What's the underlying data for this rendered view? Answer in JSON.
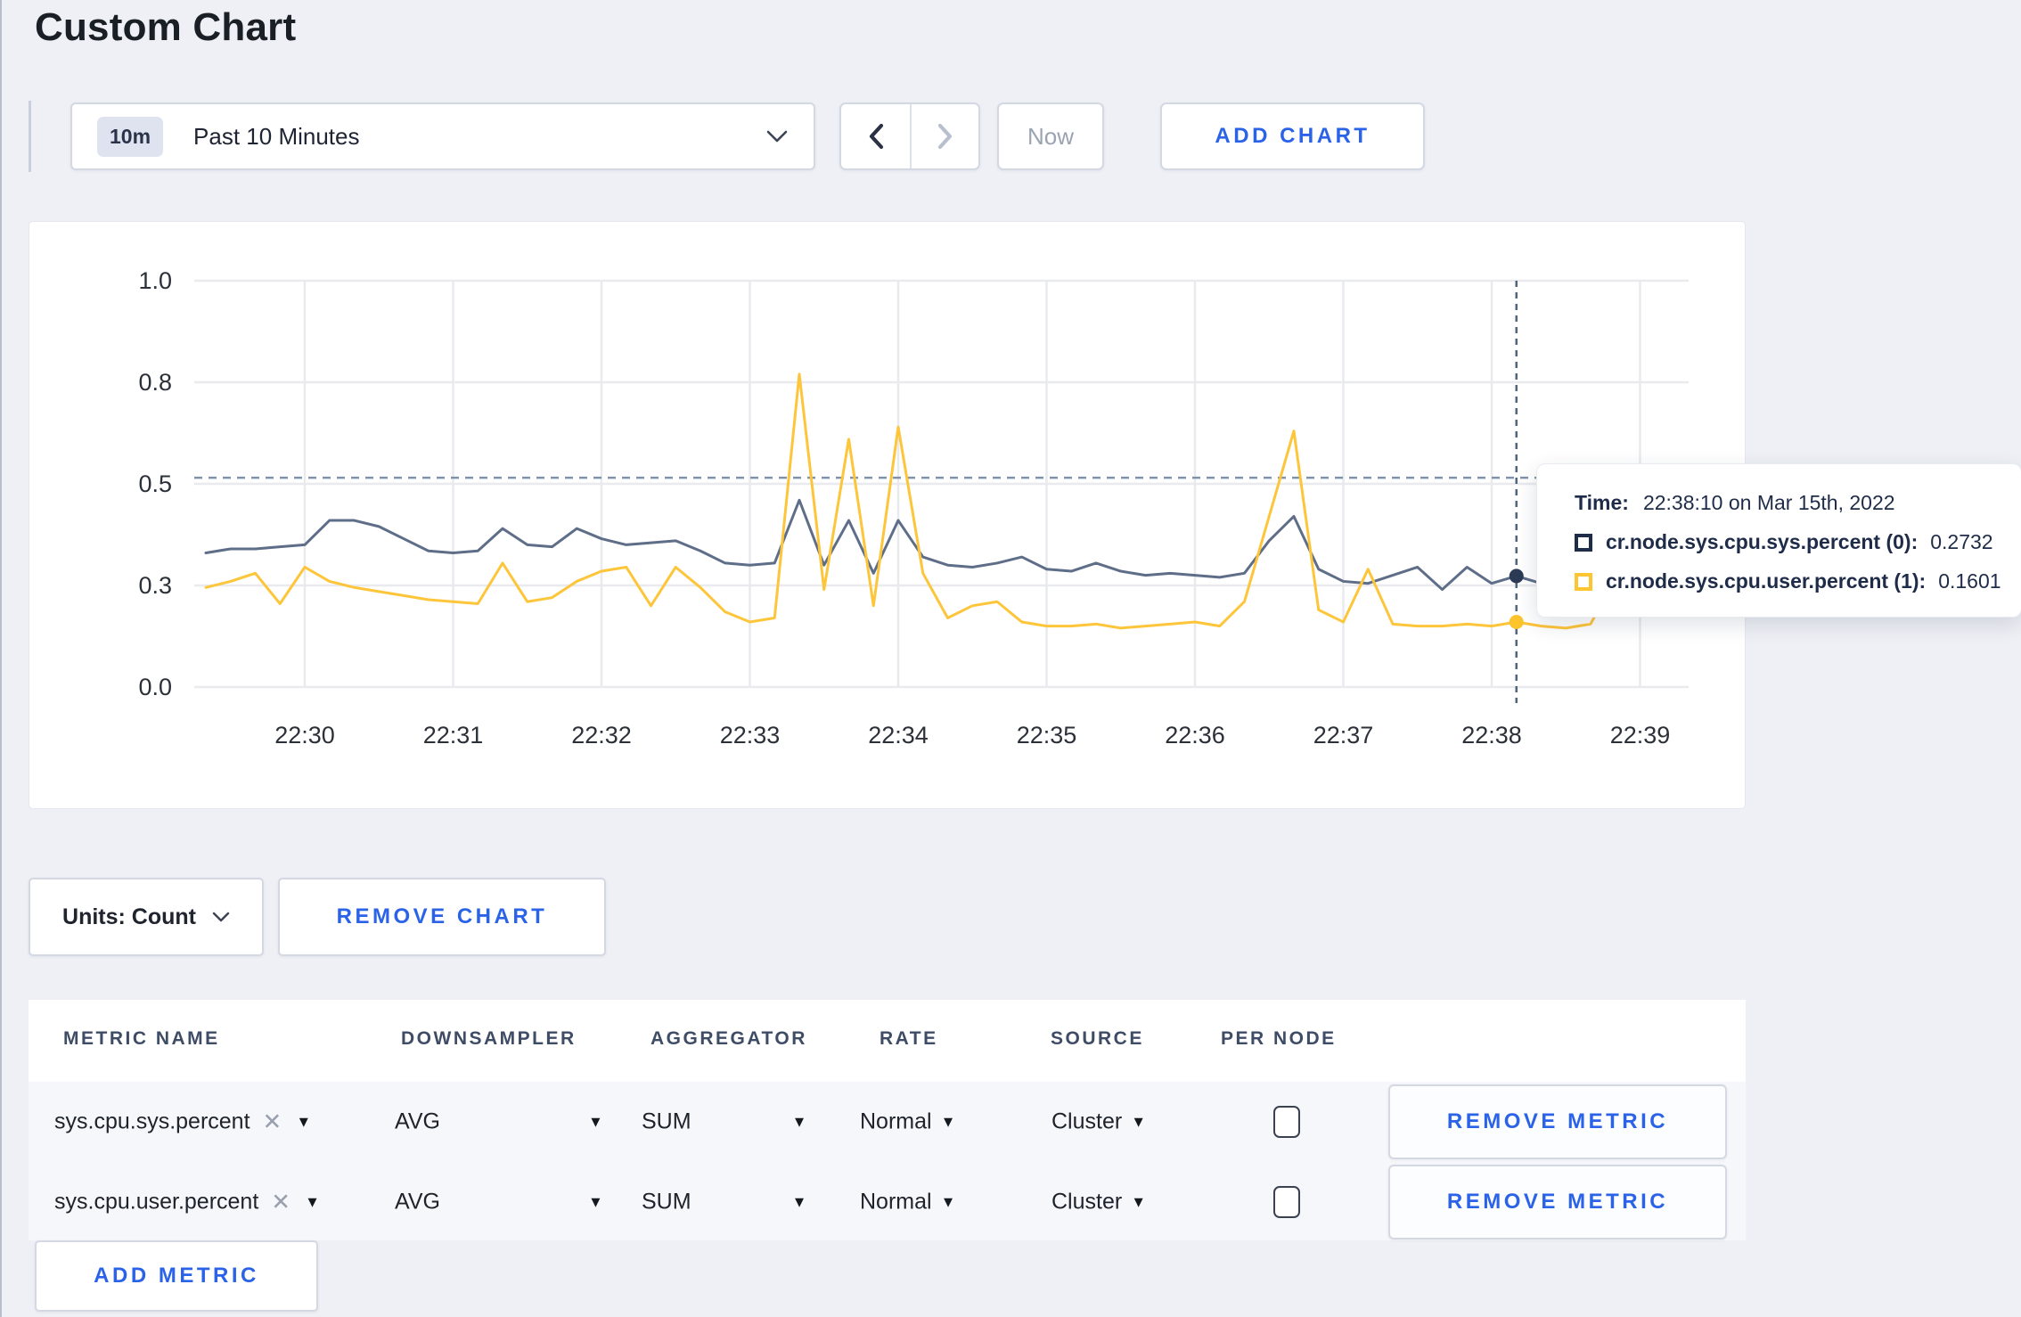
{
  "title": "Custom Chart",
  "controls": {
    "time_window_badge": "10m",
    "time_window_label": "Past 10 Minutes",
    "now_label": "Now",
    "add_chart_label": "ADD CHART"
  },
  "chart_footer": {
    "units_label": "Units: Count",
    "remove_chart_label": "REMOVE CHART"
  },
  "tooltip": {
    "time_label": "Time:",
    "time_value": "22:38:10 on Mar 15th, 2022",
    "series": [
      {
        "label": "cr.node.sys.cpu.sys.percent (0):",
        "value": "0.2732",
        "color": "#1f2c49"
      },
      {
        "label": "cr.node.sys.cpu.user.percent (1):",
        "value": "0.1601",
        "color": "#fdc530"
      }
    ]
  },
  "table": {
    "headers": [
      "METRIC NAME",
      "DOWNSAMPLER",
      "AGGREGATOR",
      "RATE",
      "SOURCE",
      "PER NODE"
    ],
    "rows": [
      {
        "metric": "sys.cpu.sys.percent",
        "downsampler": "AVG",
        "aggregator": "SUM",
        "rate": "Normal",
        "source": "Cluster",
        "per_node_checked": false,
        "remove_label": "REMOVE METRIC"
      },
      {
        "metric": "sys.cpu.user.percent",
        "downsampler": "AVG",
        "aggregator": "SUM",
        "rate": "Normal",
        "source": "Cluster",
        "per_node_checked": false,
        "remove_label": "REMOVE METRIC"
      }
    ],
    "add_metric_label": "ADD METRIC"
  },
  "chart_data": {
    "type": "line",
    "x_start": "22:29:20",
    "x_step_seconds": 10,
    "x_tick_labels": [
      "22:30",
      "22:31",
      "22:32",
      "22:33",
      "22:34",
      "22:35",
      "22:36",
      "22:37",
      "22:38",
      "22:39"
    ],
    "y_ticks": [
      {
        "value": 0.0,
        "label": "0.0"
      },
      {
        "value": 0.25,
        "label": "0.3"
      },
      {
        "value": 0.5,
        "label": "0.5"
      },
      {
        "value": 0.75,
        "label": "0.8"
      },
      {
        "value": 1.0,
        "label": "1.0"
      }
    ],
    "ylim": [
      0,
      1
    ],
    "grid": true,
    "series": [
      {
        "name": "cr.node.sys.cpu.sys.percent",
        "color": "#5f6e88",
        "values": [
          0.33,
          0.34,
          0.34,
          0.345,
          0.35,
          0.41,
          0.41,
          0.395,
          0.365,
          0.335,
          0.33,
          0.335,
          0.39,
          0.35,
          0.345,
          0.39,
          0.365,
          0.35,
          0.355,
          0.36,
          0.335,
          0.305,
          0.3,
          0.305,
          0.46,
          0.3,
          0.41,
          0.28,
          0.41,
          0.32,
          0.3,
          0.295,
          0.305,
          0.32,
          0.29,
          0.285,
          0.305,
          0.285,
          0.275,
          0.28,
          0.275,
          0.27,
          0.28,
          0.36,
          0.42,
          0.29,
          0.26,
          0.255,
          0.275,
          0.295,
          0.24,
          0.295,
          0.255,
          0.2732,
          0.255,
          0.265,
          0.275,
          0.265,
          0.27,
          0.265,
          0.27
        ]
      },
      {
        "name": "cr.node.sys.cpu.user.percent",
        "color": "#fdc53a",
        "values": [
          0.245,
          0.26,
          0.28,
          0.205,
          0.295,
          0.26,
          0.245,
          0.235,
          0.225,
          0.215,
          0.21,
          0.205,
          0.305,
          0.21,
          0.22,
          0.26,
          0.285,
          0.295,
          0.2,
          0.295,
          0.245,
          0.185,
          0.16,
          0.17,
          0.77,
          0.24,
          0.61,
          0.2,
          0.64,
          0.28,
          0.17,
          0.2,
          0.21,
          0.16,
          0.15,
          0.15,
          0.155,
          0.145,
          0.15,
          0.155,
          0.16,
          0.15,
          0.21,
          0.42,
          0.63,
          0.19,
          0.16,
          0.29,
          0.155,
          0.15,
          0.15,
          0.155,
          0.15,
          0.1601,
          0.15,
          0.145,
          0.155,
          0.27,
          0.28,
          0.275,
          0.22
        ]
      }
    ],
    "hover": {
      "index": 53,
      "time": "22:38:10 on Mar 15th, 2022",
      "values": [
        0.2732,
        0.1601
      ],
      "hline_value": 0.515
    }
  }
}
